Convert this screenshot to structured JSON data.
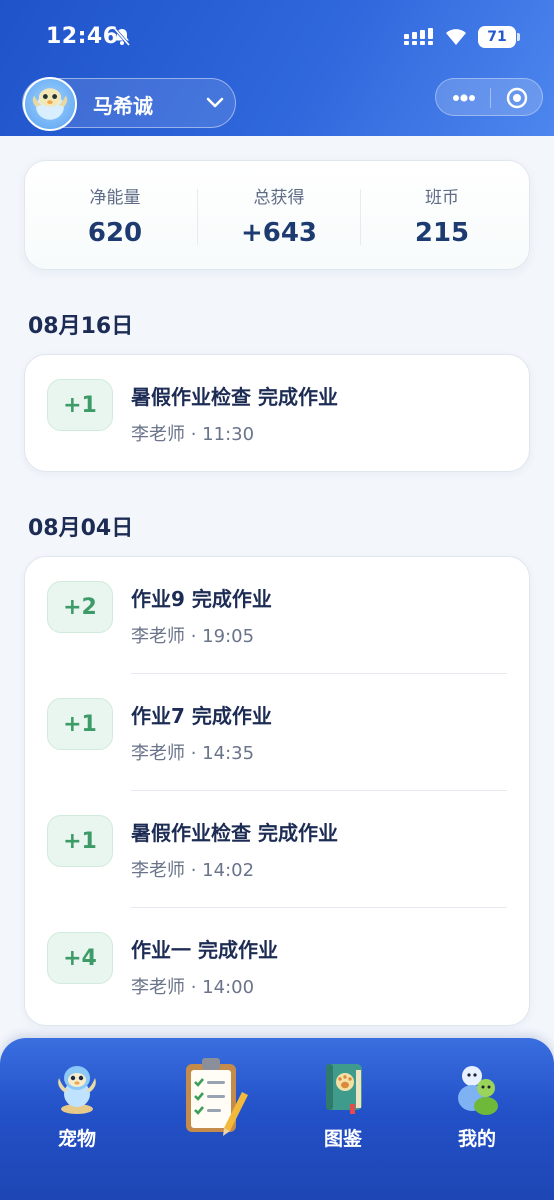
{
  "status_bar": {
    "time": "12:46",
    "battery": "71"
  },
  "header": {
    "user_name": "马希诚"
  },
  "summary": {
    "stats": [
      {
        "label": "净能量",
        "value": "620"
      },
      {
        "label": "总获得",
        "value": "+643"
      },
      {
        "label": "班币",
        "value": "215"
      }
    ]
  },
  "sections": [
    {
      "date": "08月16日",
      "records": [
        {
          "points": "+1",
          "title": "暑假作业检查 完成作业",
          "meta": "李老师 · 11:30"
        }
      ]
    },
    {
      "date": "08月04日",
      "records": [
        {
          "points": "+2",
          "title": "作业9 完成作业",
          "meta": "李老师 · 19:05"
        },
        {
          "points": "+1",
          "title": "作业7 完成作业",
          "meta": "李老师 · 14:35"
        },
        {
          "points": "+1",
          "title": "暑假作业检查 完成作业",
          "meta": "李老师 · 14:02"
        },
        {
          "points": "+4",
          "title": "作业一 完成作业",
          "meta": "李老师 · 14:00"
        }
      ]
    }
  ],
  "bottom_nav": {
    "items": [
      {
        "label": "宠物",
        "icon": "pet-icon"
      },
      {
        "label": "",
        "icon": "clipboard-checklist-icon"
      },
      {
        "label": "图鉴",
        "icon": "paw-book-icon"
      },
      {
        "label": "我的",
        "icon": "profile-figures-icon"
      }
    ]
  },
  "colors": {
    "header_blue": "#2458cf",
    "points_green": "#3d9b68",
    "text_dark": "#1d2c55"
  }
}
